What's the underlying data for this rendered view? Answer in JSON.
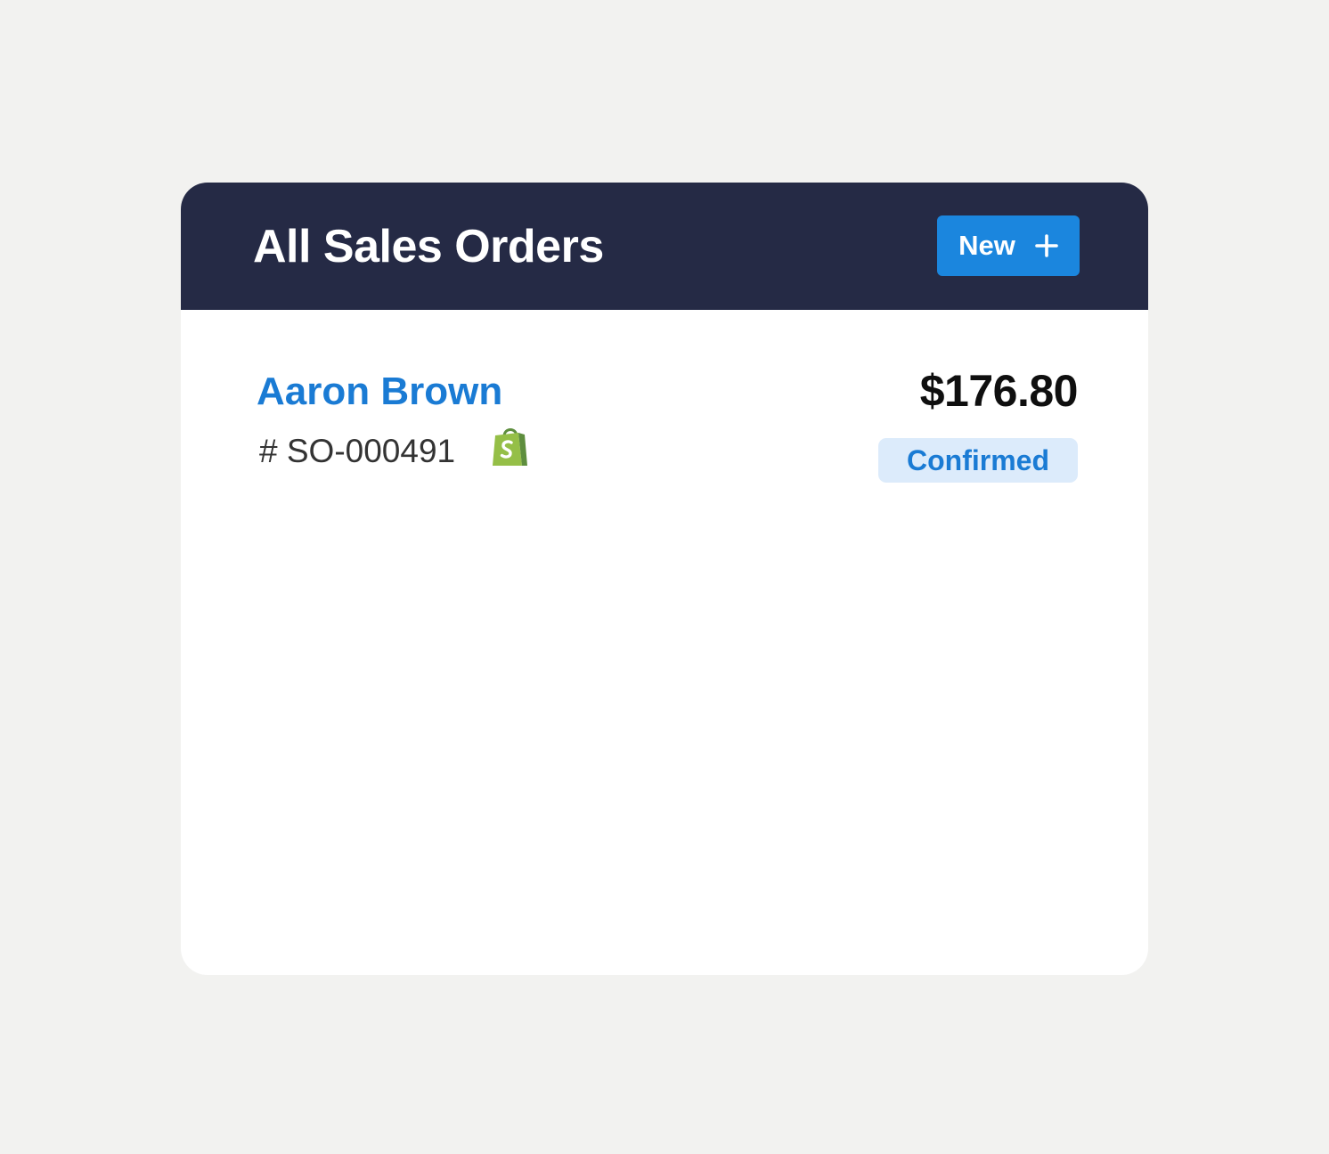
{
  "header": {
    "title": "All Sales Orders",
    "new_button_label": "New",
    "new_button_icon": "plus-icon"
  },
  "orders": [
    {
      "customer": "Aaron Brown",
      "order_number": "# SO-000491",
      "channel_icon": "shopify-bag-icon",
      "amount": "$176.80",
      "status": "Confirmed"
    }
  ],
  "colors": {
    "page_background": "#f2f2f0",
    "header_background": "#252a45",
    "accent": "#1b86de",
    "link": "#1a7bd4",
    "status_background": "#dcebfb",
    "shopify_green": "#95bf47"
  }
}
